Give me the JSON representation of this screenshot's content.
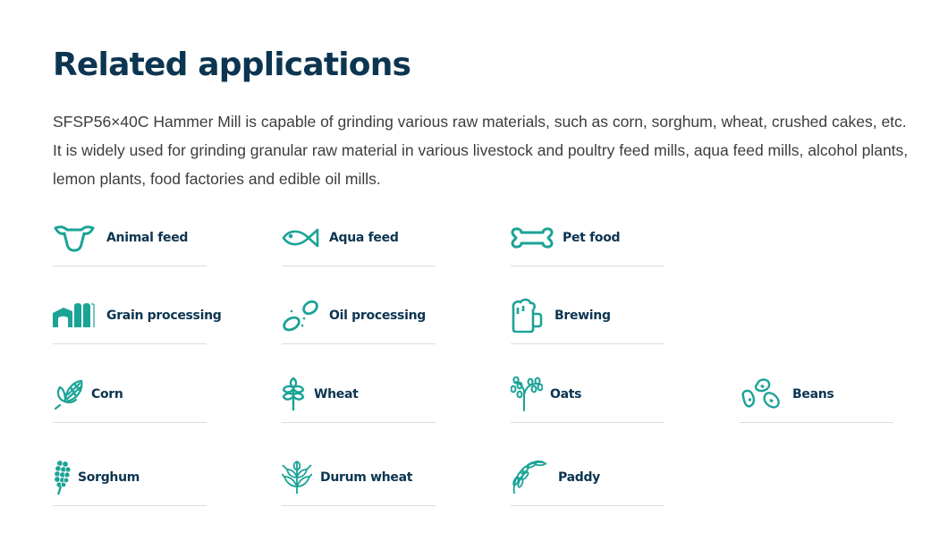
{
  "section": {
    "title": "Related applications",
    "description": "SFSP56×40C Hammer Mill is capable of grinding various raw materials, such as corn, sorghum, wheat, crushed cakes, etc. It is widely used for grinding granular raw material in various livestock and poultry feed mills, aqua feed mills, alcohol plants, lemon plants, food factories and edible oil mills."
  },
  "colors": {
    "accent": "#1aa396",
    "heading": "#0c3551",
    "body_text": "#3d3d3d",
    "divider": "#dcdcdc"
  },
  "applications": [
    {
      "label": "Animal feed",
      "icon": "cow-head-icon"
    },
    {
      "label": "Aqua feed",
      "icon": "fish-icon"
    },
    {
      "label": "Pet food",
      "icon": "bone-icon"
    },
    {
      "label": "Grain processing",
      "icon": "grain-silo-icon"
    },
    {
      "label": "Oil processing",
      "icon": "oil-drops-icon"
    },
    {
      "label": "Brewing",
      "icon": "beer-mug-icon"
    },
    {
      "label": "Corn",
      "icon": "corn-icon"
    },
    {
      "label": "Wheat",
      "icon": "wheat-icon"
    },
    {
      "label": "Oats",
      "icon": "oats-icon"
    },
    {
      "label": "Beans",
      "icon": "beans-icon"
    },
    {
      "label": "Sorghum",
      "icon": "sorghum-icon"
    },
    {
      "label": "Durum wheat",
      "icon": "durum-wheat-icon"
    },
    {
      "label": "Paddy",
      "icon": "paddy-icon"
    }
  ]
}
